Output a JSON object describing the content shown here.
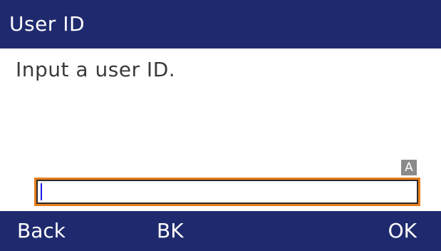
{
  "header": {
    "title": "User ID"
  },
  "main": {
    "prompt": "Input a user ID.",
    "input_mode_badge": "A",
    "user_id_value": ""
  },
  "softkeys": {
    "key1": "Back",
    "key2": "BK",
    "key4": "OK"
  },
  "colors": {
    "bar_background": "#1f2a6e",
    "input_focus_border": "#e87e1c",
    "caret": "#1a1ae6",
    "badge": "#8a8a8a"
  }
}
